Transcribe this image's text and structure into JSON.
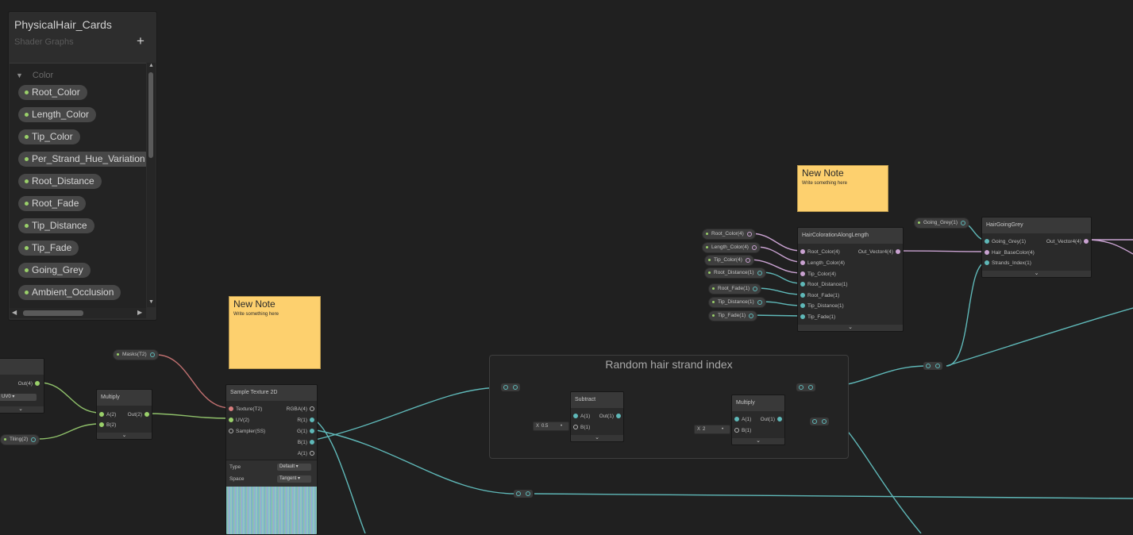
{
  "blackboard": {
    "title": "PhysicalHair_Cards",
    "subtitle": "Shader Graphs",
    "add_icon": "+",
    "category": "Color",
    "properties": [
      "Root_Color",
      "Length_Color",
      "Tip_Color",
      "Per_Strand_Hue_Variation",
      "Root_Distance",
      "Root_Fade",
      "Tip_Distance",
      "Tip_Fade",
      "Going_Grey",
      "Ambient_Occlusion"
    ]
  },
  "notes": {
    "note1": {
      "title": "New Note",
      "body": "Write something here"
    },
    "note2": {
      "title": "New Note",
      "body": "Write something here"
    }
  },
  "group": {
    "title": "Random hair strand index"
  },
  "left_partial_node": {
    "out_port": "Out(4)",
    "uv_label": "UV0"
  },
  "multiply_left": {
    "title": "Multiply",
    "in_a": "A(2)",
    "in_b": "B(2)",
    "out": "Out(2)"
  },
  "props_left": {
    "masks": "Masks(T2)",
    "tiling": "Tiling(2)"
  },
  "sample_texture": {
    "title": "Sample Texture 2D",
    "in_texture": "Texture(T2)",
    "in_uv": "UV(2)",
    "in_sampler": "Sampler(SS)",
    "out_rgba": "RGBA(4)",
    "out_r": "R(1)",
    "out_g": "G(1)",
    "out_b": "B(1)",
    "out_a": "A(1)",
    "type_label": "Type",
    "type_value": "Default",
    "space_label": "Space",
    "space_value": "Tangent"
  },
  "subtract": {
    "title": "Subtract",
    "in_a": "A(1)",
    "in_b": "B(1)",
    "out": "Out(1)",
    "b_value": "0.5",
    "x": "X"
  },
  "multiply_mid": {
    "title": "Multiply",
    "in_a": "A(1)",
    "in_b": "B(1)",
    "out": "Out(1)",
    "b_value": "2",
    "x": "X"
  },
  "hair_coloration": {
    "title": "HairColorationAlongLength",
    "inputs": [
      "Root_Color(4)",
      "Length_Color(4)",
      "Tip_Color(4)",
      "Root_Distance(1)",
      "Root_Fade(1)",
      "Tip_Distance(1)",
      "Tip_Fade(1)"
    ],
    "out": "Out_Vector4(4)"
  },
  "hair_props": [
    "Root_Color(4)",
    "Length_Color(4)",
    "Tip_Color(4)",
    "Root_Distance(1)",
    "Root_Fade(1)",
    "Tip_Distance(1)",
    "Tip_Fade(1)"
  ],
  "hair_going_grey": {
    "title": "HairGoingGrey",
    "inputs": [
      "Going_Grey(1)",
      "Hair_BaseColor(4)",
      "Strands_Index(1)"
    ],
    "out": "Out_Vector4(4)",
    "prop": "Going_Grey(1)"
  },
  "colors": {
    "background": "#202020",
    "sticky_note": "#fdd06e",
    "wire_teal": "#5fb8b8",
    "wire_pink": "#c9a2d1",
    "wire_green": "#9ad06a",
    "wire_red": "#d77c7c"
  },
  "icons": {
    "category_toggle": "triangle-down-icon",
    "scroll_up": "arrow-up-icon",
    "scroll_down": "arrow-down-icon",
    "scroll_left": "arrow-left-icon",
    "scroll_right": "arrow-right-icon",
    "collapse": "chevron-down-icon"
  }
}
